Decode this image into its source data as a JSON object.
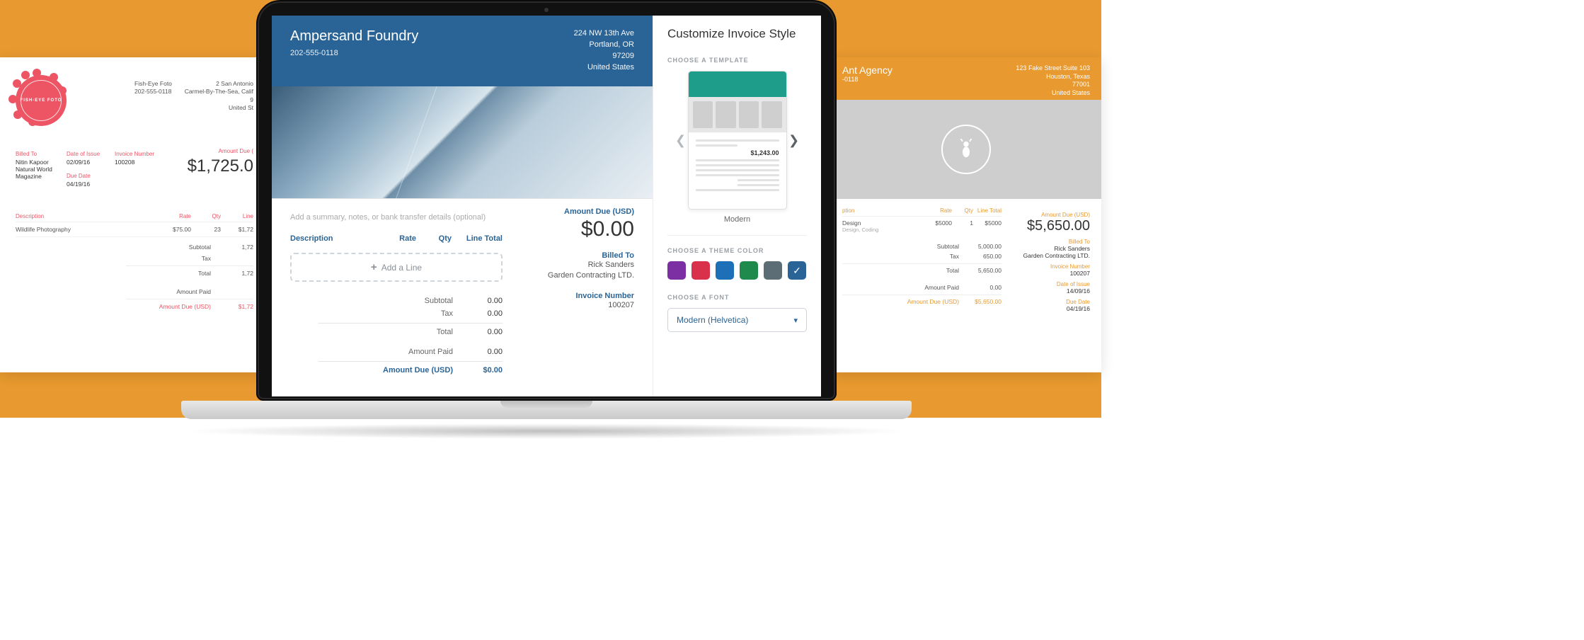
{
  "left_invoice": {
    "logo_text": "FISH-EYE FOTO",
    "sender_name": "Fish-Eye Foto",
    "sender_phone": "202-555-0118",
    "addr_l1": "2 San Antonio",
    "addr_l2": "Carmel-By-The-Sea, Calif",
    "addr_l3": "9",
    "addr_l4": "United St",
    "labels": {
      "billed_to": "Billed To",
      "date_issue": "Date of Issue",
      "invoice_no": "Invoice Number",
      "due_date": "Due Date",
      "amount_due": "Amount Due (",
      "desc": "Description",
      "rate": "Rate",
      "qty": "Qty",
      "line_total": "Line",
      "subtotal": "Subtotal",
      "tax": "Tax",
      "total": "Total",
      "amount_paid": "Amount Paid",
      "amount_due_full": "Amount Due (USD)"
    },
    "billed_to_l1": "Nitin Kapoor",
    "billed_to_l2": "Natural World Magazine",
    "date_issue": "02/09/16",
    "invoice_no": "100208",
    "due_date": "04/19/16",
    "amount_due": "$1,725.0",
    "item": {
      "desc": "Wildlife Photography",
      "rate": "$75.00",
      "qty": "23",
      "total": "$1,72"
    },
    "totals": {
      "subtotal": "1,72",
      "tax": "",
      "total": "1,72",
      "paid": "",
      "due": "$1,72"
    }
  },
  "right_invoice": {
    "name": "Ant Agency",
    "phone": "-0118",
    "addr_l1": "123 Fake Street Suite 103",
    "addr_l2": "Houston, Texas",
    "addr_l3": "77001",
    "addr_l4": "United States",
    "labels": {
      "desc": "ption",
      "rate": "Rate",
      "qty": "Qty",
      "line_total": "Line Total",
      "amount_due": "Amount Due (USD)",
      "billed_to": "Billed To",
      "invoice_no": "Invoice Number",
      "date_issue": "Date of Issue",
      "due_date": "Due Date",
      "subtotal": "Subtotal",
      "tax": "Tax",
      "total": "Total",
      "amount_paid": "Amount Paid",
      "amount_due_full": "Amount Due (USD)"
    },
    "amount_due": "$5,650.00",
    "billed_to_l1": "Rick Sanders",
    "billed_to_l2": "Garden Contracting LTD.",
    "invoice_no": "100207",
    "date_issue": "14/09/16",
    "due_date": "04/19/16",
    "item": {
      "desc": "Design",
      "sub": "Design, Coding",
      "rate": "$5000",
      "qty": "1",
      "total": "$5000"
    },
    "totals": {
      "subtotal": "5,000.00",
      "tax": "650.00",
      "total": "5,650.00",
      "paid": "0.00",
      "due": "$5,650.00"
    }
  },
  "editor": {
    "company": "Ampersand Foundry",
    "phone": "202-555-0118",
    "addr_l1": "224 NW 13th Ave",
    "addr_l2": "Portland, OR",
    "addr_l3": "97209",
    "addr_l4": "United States",
    "summary_placeholder": "Add a summary, notes, or bank transfer details (optional)",
    "labels": {
      "amount_due": "Amount Due (USD)",
      "desc": "Description",
      "rate": "Rate",
      "qty": "Qty",
      "line_total": "Line Total",
      "add_line": "Add a Line",
      "subtotal": "Subtotal",
      "tax": "Tax",
      "total": "Total",
      "amount_paid": "Amount Paid",
      "amount_due_full": "Amount Due (USD)",
      "billed_to": "Billed To",
      "invoice_no": "Invoice Number"
    },
    "amount_due": "$0.00",
    "billed_to_l1": "Rick Sanders",
    "billed_to_l2": "Garden Contracting LTD.",
    "invoice_no": "100207",
    "totals": {
      "subtotal": "0.00",
      "tax": "0.00",
      "total": "0.00",
      "paid": "0.00",
      "due": "$0.00"
    }
  },
  "panel": {
    "title": "Customize Invoice Style",
    "choose_template": "CHOOSE A TEMPLATE",
    "template_name": "Modern",
    "template_amount": "$1,243.00",
    "choose_color": "CHOOSE A THEME COLOR",
    "choose_font": "CHOOSE A FONT",
    "font_value": "Modern (Helvetica)",
    "colors": [
      "#7b2fa3",
      "#d9304c",
      "#1d6fb8",
      "#1e8a4c",
      "#5d6d76",
      "#2a6496"
    ]
  }
}
